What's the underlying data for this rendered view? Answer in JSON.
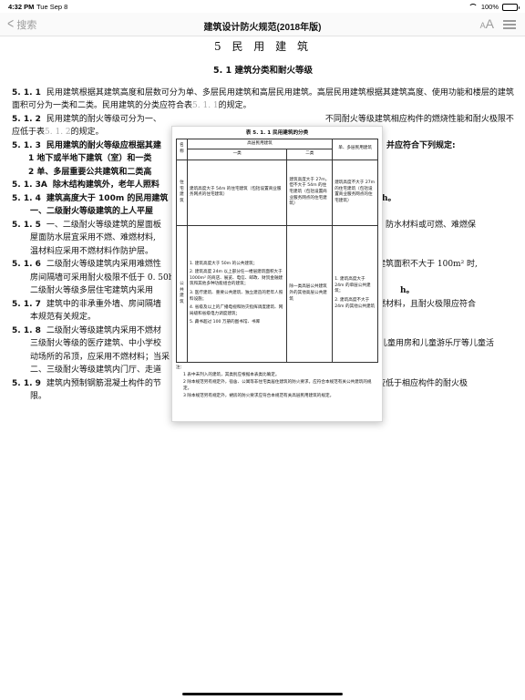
{
  "status_bar": {
    "time": "4:32 PM",
    "date": "Tue Sep 8",
    "battery_text": "100%",
    "battery_level": 1.0,
    "wifi_icon": "wifi-icon",
    "battery_icon": "battery-icon"
  },
  "nav": {
    "back_label": "搜索",
    "back_icon": "chevron-left-icon",
    "title": "建筑设计防火规范(2018年版)",
    "font_size_label_small": "A",
    "font_size_label_large": "A",
    "toc_icon": "list-icon"
  },
  "doc": {
    "chapter": "5 民 用 建 筑",
    "section": "5. 1 建筑分类和耐火等级",
    "clauses": [
      {
        "num": "5. 1. 1",
        "text": "民用建筑根据其建筑高度和层数可分为单、多层民用建筑和高层民用建筑。高层民用建筑根据其建筑高度、使用功能和楼层的建筑面积可分为一类和二类。民用建筑的分类应符合表",
        "ref": "5. 1. 1",
        "tail": "的规定。"
      },
      {
        "num": "5. 1. 2",
        "text": "民用建筑的耐火等级可分为一、",
        "frag": "不同耐火等级建筑相应构件的燃烧性能和耐火极限不应低于表",
        "ref": "5. 1. 2",
        "tail": "的规定。"
      },
      {
        "num": "5. 1. 3",
        "text": "民用建筑的耐火等级应根据其建",
        "tail": "并应符合下列规定:"
      },
      {
        "text": "1 地下或半地下建筑（室）和一类"
      },
      {
        "text": "2 单、多层重要公共建筑和二类高"
      },
      {
        "num": "5. 1. 3A",
        "text": "除木结构建筑外，老年人照料"
      },
      {
        "num": "5. 1. 4",
        "text": "建筑高度大于 100m 的民用建筑",
        "tail": "h。"
      },
      {
        "text": "一、二级耐火等级建筑的上人平屋"
      },
      {
        "num": "5. 1. 5",
        "text": "一、二级耐火等级建筑的屋面板",
        "tail": "上时，防水材料或可燃、难燃保"
      },
      {
        "text": "屋面防水层宜采用不燃、难燃材料,"
      },
      {
        "text": "温材料应采用不燃材料作防护层。"
      },
      {
        "num": "5. 1. 6",
        "text": "二级耐火等级建筑内采用难燃性",
        "tail": "间的建筑面积不大于 100m² 时,"
      },
      {
        "text": "房间隔墙可采用耐火极限不低于 0. 50h 的"
      },
      {
        "text": "二级耐火等级多层住宅建筑内采用",
        "tail": "h。"
      },
      {
        "num": "5. 1. 7",
        "text": "建筑中的非承重外墙、房间隔墙",
        "tail": "为不燃材料，且耐火极限应符合"
      },
      {
        "text": "本规范有关规定。"
      },
      {
        "num": "5. 1. 8",
        "text": "二级耐火等级建筑内采用不燃材"
      },
      {
        "text": "三级耐火等级的医疗建筑、中小学校",
        "tail": "儿童用房和儿童游乐厅等儿童活"
      },
      {
        "text": "动场所的吊顶，应采用不燃材料；当采"
      },
      {
        "text": "二、三级耐火等级建筑内门厅、走道"
      },
      {
        "num": "5. 1. 9",
        "text": "建筑内预制钢筋混凝土构件的节",
        "tail": "限不应低于相应构件的耐火极"
      },
      {
        "text": "限。"
      }
    ]
  },
  "table_popup": {
    "caption": "表 5. 1. 1   民用建筑的分类",
    "headers": {
      "name": "名称",
      "high_rise": "高层民用建筑",
      "class1": "一类",
      "class2": "二类",
      "low_rise": "单、多层民用建筑"
    },
    "rows": [
      {
        "name": "住宅建筑",
        "class1": "建筑高度大于 54m 的住宅建筑（包括设置商业服务网点的住宅建筑）",
        "class2": "建筑高度大于 27m，但不大于 54m 的住宅建筑（包括设置商业服务网点的住宅建筑）",
        "low_rise": "建筑高度不大于 27m 的住宅建筑（包括设置商业服务网点的住宅建筑）"
      },
      {
        "name": "公共建筑",
        "class1_items": [
          "1. 建筑高度大于 50m 的公共建筑；",
          "2. 建筑高度 24m 以上部分任一楼层建筑面积大于 1000m² 的商店、展览、电信、邮政、财贸金融建筑和其他多种功能组合的建筑；",
          "3. 医疗建筑、重要公共建筑、独立建造的老年人照料设施；",
          "4. 省级及以上的广播电视和防灾指挥调度建筑、网局级和省级电力调度建筑；",
          "5. 藏书超过 100 万册的图书馆、书库"
        ],
        "class2": "除一类高层公共建筑外的其他高层公共建筑",
        "low_rise_items": [
          "1. 建筑高度大于 24m 的单层公共建筑；",
          "2. 建筑高度不大于 24m 的其他公共建筑"
        ]
      }
    ],
    "notes_label": "注：",
    "notes": [
      "1 表中未列入的建筑，其类别应根据本表类比确定。",
      "2 除本规范另有规定外，宿舍、公寓等非住宅类居住建筑的防火要求，应符合本规范有关公共建筑的规定。",
      "3 除本规范另有规定外，裙房的防火要求应符合本规范有关高层民用建筑的规定。"
    ]
  }
}
